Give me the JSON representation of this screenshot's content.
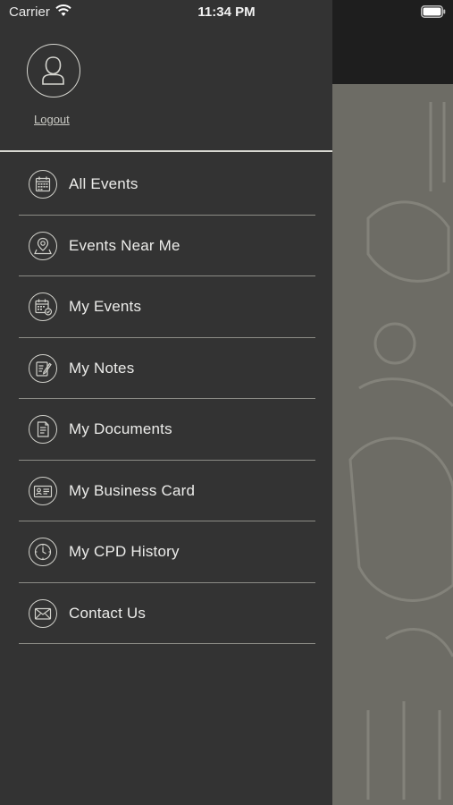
{
  "status_bar": {
    "carrier": "Carrier",
    "time": "11:34 PM",
    "wifi_icon": "wifi-icon",
    "battery_icon": "battery-icon"
  },
  "profile": {
    "avatar_icon": "user-avatar-icon",
    "logout_label": "Logout"
  },
  "menu": {
    "items": [
      {
        "label": "All Events",
        "icon": "calendar-icon"
      },
      {
        "label": "Events Near Me",
        "icon": "location-pin-icon"
      },
      {
        "label": "My Events",
        "icon": "calendar-check-icon"
      },
      {
        "label": "My Notes",
        "icon": "notepad-pencil-icon"
      },
      {
        "label": "My Documents",
        "icon": "document-icon"
      },
      {
        "label": "My Business Card",
        "icon": "business-card-icon"
      },
      {
        "label": "My CPD History",
        "icon": "clock-icon"
      },
      {
        "label": "Contact Us",
        "icon": "envelope-icon"
      }
    ]
  },
  "colors": {
    "drawer_background": "#333333",
    "header_background": "#1e1e1e",
    "content_background": "#6d6c65",
    "text": "#ececea",
    "divider": "#8c8c86"
  }
}
